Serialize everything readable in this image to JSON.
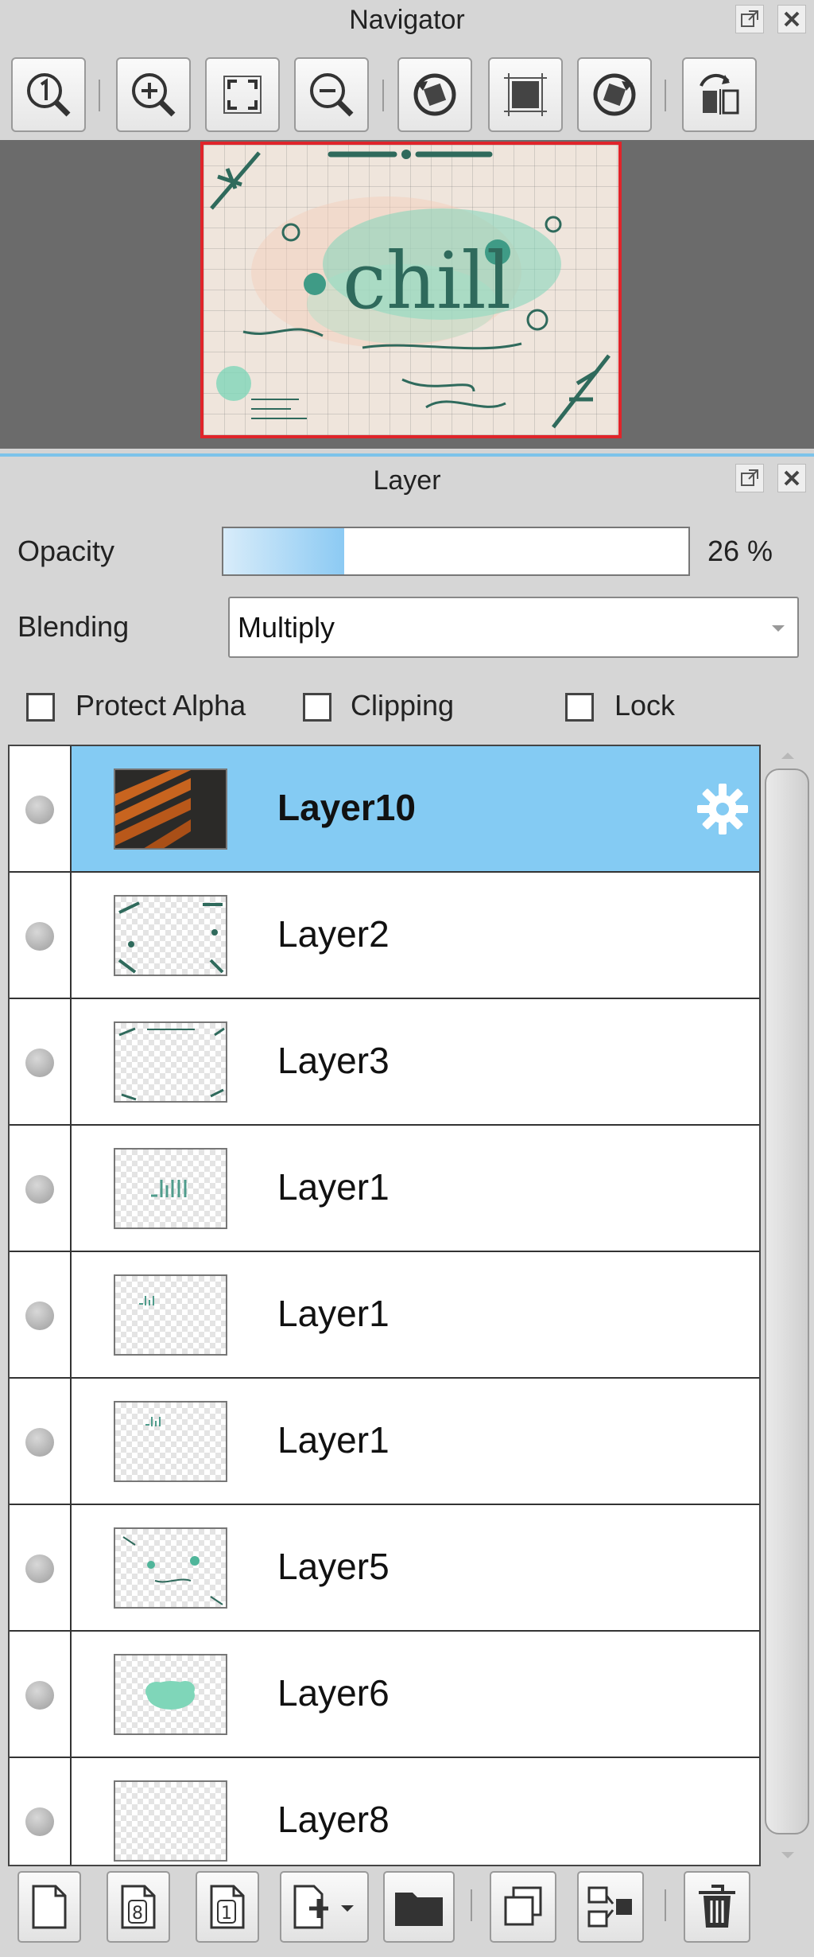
{
  "navigator": {
    "title": "Navigator",
    "tools": [
      "actual-size",
      "zoom-in",
      "fit-window",
      "zoom-out",
      "rotate-left",
      "reset-rotation",
      "rotate-right",
      "flip-horizontal"
    ],
    "preview": {
      "art_text": "chill"
    }
  },
  "layer_panel": {
    "title": "Layer",
    "opacity_label": "Opacity",
    "opacity_value": "26 %",
    "opacity_fraction": 0.26,
    "blending_label": "Blending",
    "blending_value": "Multiply",
    "protect_alpha_label": "Protect Alpha",
    "clipping_label": "Clipping",
    "lock_label": "Lock",
    "layers": [
      {
        "name": "Layer10",
        "selected": true
      },
      {
        "name": "Layer2"
      },
      {
        "name": "Layer3"
      },
      {
        "name": "Layer1"
      },
      {
        "name": "Layer1"
      },
      {
        "name": "Layer1"
      },
      {
        "name": "Layer5"
      },
      {
        "name": "Layer6"
      },
      {
        "name": "Layer8"
      }
    ]
  },
  "bottom_toolbar": {
    "buttons": [
      "new-layer",
      "new-8bit-layer",
      "new-1bit-layer",
      "add-layer-menu",
      "new-folder",
      "duplicate-layer",
      "merge-down",
      "delete-layer"
    ],
    "icon_labels": {
      "new_8bit": "8",
      "new_1bit": "1"
    }
  },
  "colors": {
    "selection": "#84cbf3",
    "accent": "#7cc3ea",
    "navigator_frame": "#e0242a",
    "art_green": "#2f6a5c",
    "art_mint": "#7fd6b9"
  }
}
